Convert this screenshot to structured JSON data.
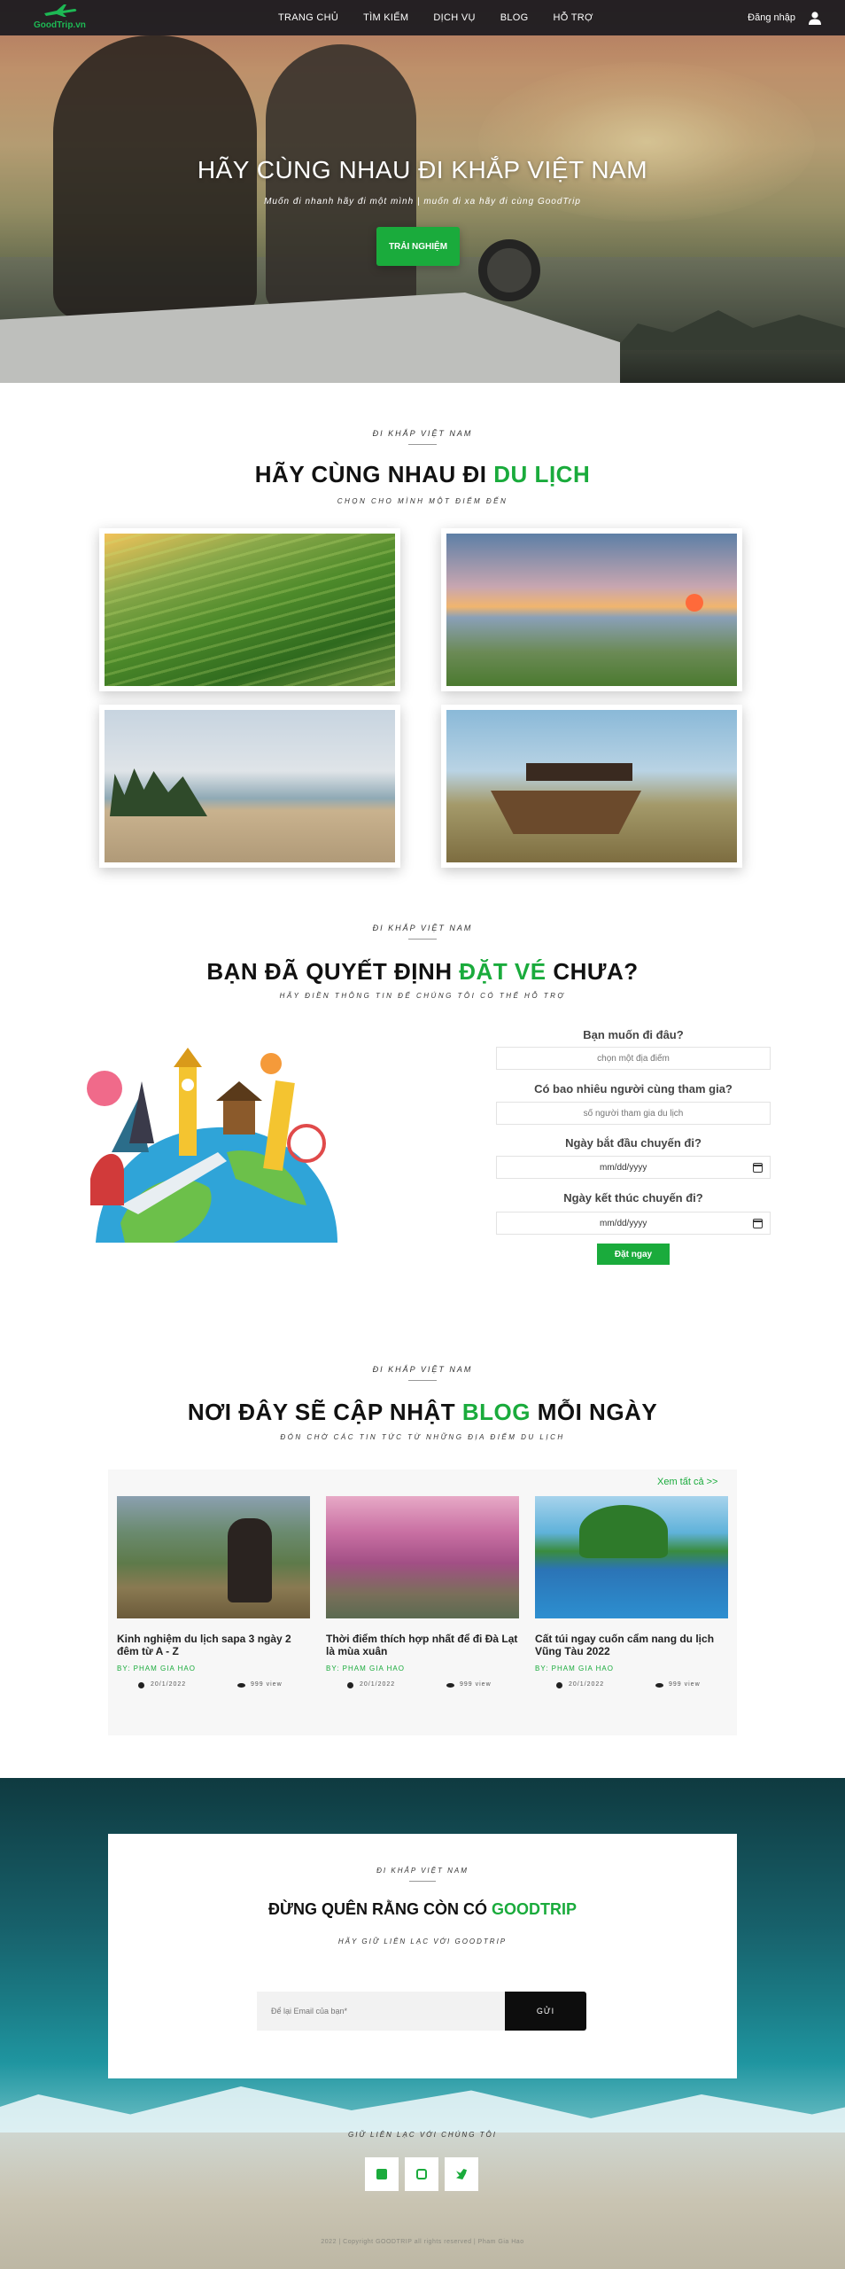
{
  "nav": {
    "logo_text": "GoodTrip.vn",
    "links": [
      "TRANG CHỦ",
      "TÌM KIẾM",
      "DỊCH VỤ",
      "BLOG",
      "HỖ TRỢ"
    ],
    "login_label": "Đăng nhập",
    "user_icon": "user-icon",
    "logo_icon": "airplane-icon"
  },
  "hero": {
    "title": "HÃY CÙNG NHAU ĐI KHẮP VIỆT NAM",
    "subtitle": "Muốn đi nhanh hãy đi một mình | muốn đi xa hãy đi cùng GoodTrip",
    "cta_label": "TRẢI NGHIỆM"
  },
  "destinations": {
    "eyebrow": "ĐI KHẮP VIỆT NAM",
    "title_prefix": "HÃY CÙNG NHAU ĐI",
    "title_highlight": "DU LỊCH",
    "subtitle": "CHỌN CHO MÌNH MỘT ĐIỂM ĐẾN"
  },
  "booking": {
    "eyebrow": "ĐI KHẮP VIỆT NAM",
    "title_prefix": "BẠN ĐÃ QUYẾT ĐỊNH",
    "title_highlight": "ĐẶT VÉ",
    "title_suffix": "CHƯA?",
    "subtitle": "HÃY ĐIỀN THÔNG TIN ĐỂ CHÚNG TÔI CÓ THỂ HỖ TRỢ",
    "q_destination": "Bạn muốn đi đâu?",
    "destination_placeholder": "chọn một địa điểm",
    "q_people": "Có bao nhiêu người cùng tham gia?",
    "people_placeholder": "số người tham gia du lịch",
    "q_start": "Ngày bắt đầu chuyến đi?",
    "start_value": "mm/dd/yyyy",
    "q_end": "Ngày kết thúc chuyến đi?",
    "end_value": "mm/dd/yyyy",
    "submit_label": "Đặt ngay"
  },
  "blog": {
    "eyebrow": "ĐI KHẮP VIỆT NAM",
    "title_prefix": "NƠI ĐÂY SẼ CẬP NHẬT",
    "title_highlight": "BLOG",
    "title_suffix": "MỖI NGÀY",
    "subtitle": "ĐÓN CHỜ CÁC TIN TỨC TỪ NHỮNG ĐỊA ĐIỂM DU LỊCH",
    "view_all": "Xem tất cả >>",
    "posts": [
      {
        "title": "Kinh nghiệm du lịch sapa 3 ngày 2 đêm từ A - Z",
        "author": "BY: PHAM GIA HAO",
        "date": "20/1/2022",
        "views": "999 view"
      },
      {
        "title": "Thời điểm thích hợp nhất để đi Đà Lạt là mùa xuân",
        "author": "BY: PHAM GIA HAO",
        "date": "20/1/2022",
        "views": "999 view"
      },
      {
        "title": "Cất túi ngay cuốn cẩm nang du lịch Vũng Tàu 2022",
        "author": "BY: PHAM GIA HAO",
        "date": "20/1/2022",
        "views": "999 view"
      }
    ]
  },
  "newsletter": {
    "eyebrow": "ĐI KHẮP VIỆT NAM",
    "title_prefix": "ĐỪNG QUÊN RẰNG CÒN CÓ",
    "title_highlight": "GOODTRIP",
    "subtitle": "HÃY GIỮ LIÊN LẠC VỚI GOODTRIP",
    "email_placeholder": "Để lại Email của bạn*",
    "submit_label": "GỬI"
  },
  "footer": {
    "contact_label": "GIỮ LIÊN LẠC VỚI CHÚNG TÔI",
    "social_icons": [
      "facebook-icon",
      "instagram-icon",
      "twitter-icon"
    ],
    "copyright": "2022 | Copyright GOODTRIP all rights reserved | Pham Gia Hao"
  },
  "colors": {
    "accent": "#1aab3c",
    "nav_bg": "#19191e"
  }
}
